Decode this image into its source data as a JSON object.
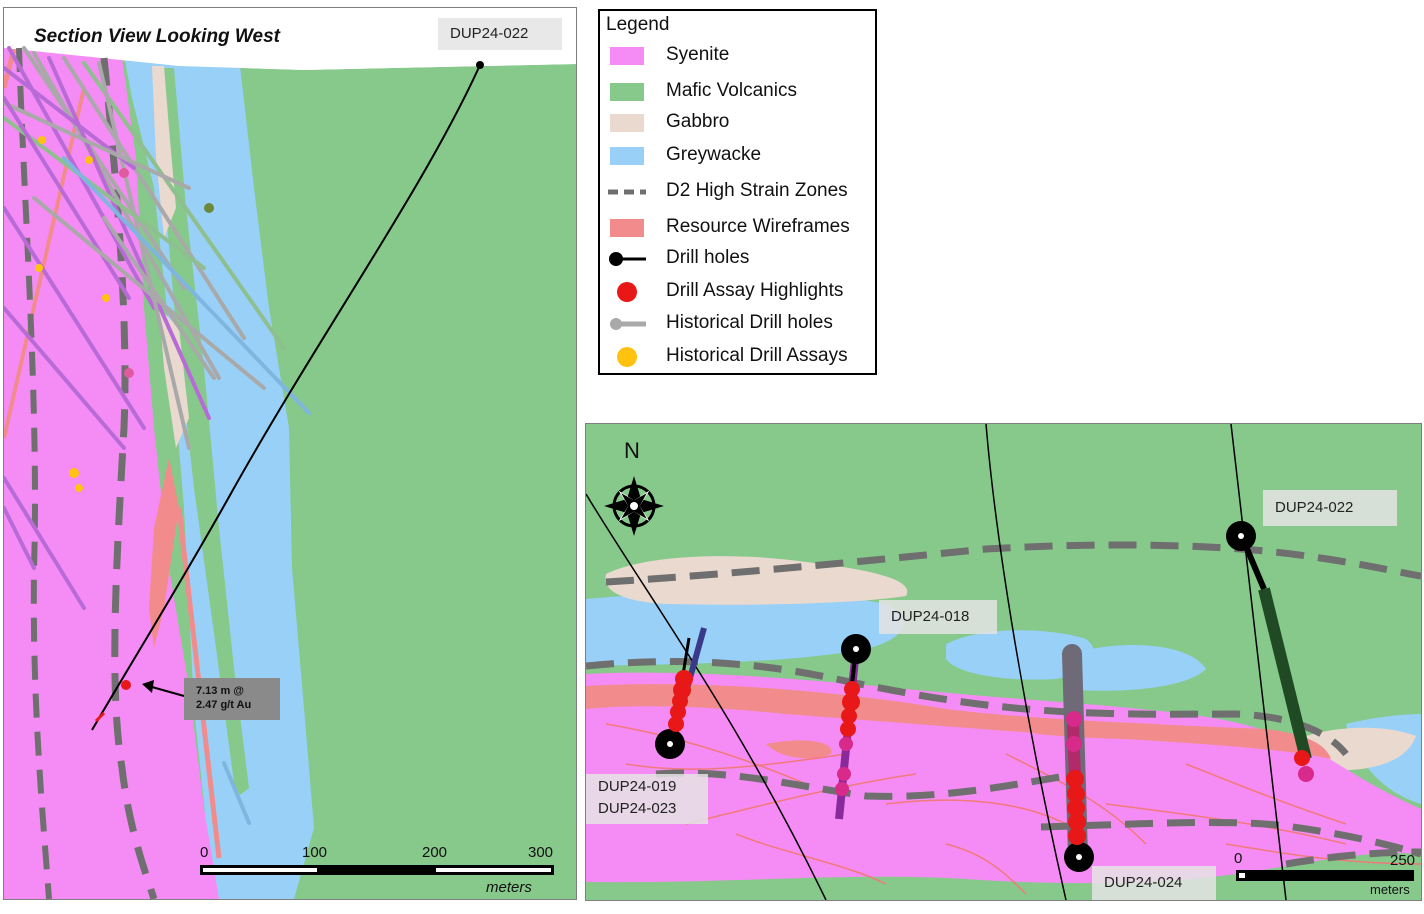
{
  "section": {
    "title": "Section View Looking West",
    "hole_label": "DUP24-022",
    "assay_callout": {
      "line1": "7.13 m @",
      "line2": "2.47 g/t Au"
    },
    "scale": {
      "ticks": [
        "0",
        "100",
        "200",
        "300"
      ],
      "unit": "meters"
    }
  },
  "legend": {
    "title": "Legend",
    "items": [
      {
        "label": "Syenite",
        "color": "#f58cf5",
        "kind": "fill"
      },
      {
        "label": "Mafic Volcanics",
        "color": "#86c98a",
        "kind": "fill"
      },
      {
        "label": "Gabbro",
        "color": "#ead9cf",
        "kind": "fill"
      },
      {
        "label": "Greywacke",
        "color": "#99d0f8",
        "kind": "fill"
      },
      {
        "label": "D2 High Strain Zones",
        "color": "#666666",
        "kind": "dash"
      },
      {
        "label": "Resource Wireframes",
        "color": "#f28c8c",
        "kind": "fill"
      },
      {
        "label": "Drill holes",
        "color": "#000000",
        "kind": "line-dot"
      },
      {
        "label": "Drill Assay Highlights",
        "color": "#e81818",
        "kind": "dot"
      },
      {
        "label": "Historical Drill holes",
        "color": "#a9a9a9",
        "kind": "line-dot-grey"
      },
      {
        "label": "Historical Drill Assays",
        "color": "#ffc20e",
        "kind": "dot"
      }
    ]
  },
  "plan": {
    "north_label": "N",
    "hole_labels": {
      "dup24_022": "DUP24-022",
      "dup24_018": "DUP24-018",
      "dup24_019": "DUP24-019",
      "dup24_023": "DUP24-023",
      "dup24_024": "DUP24-024"
    },
    "scale": {
      "start": "0",
      "end": "250",
      "unit": "meters"
    }
  },
  "colors": {
    "syenite": "#f58cf5",
    "mafic": "#86c98a",
    "gabbro": "#ead9cf",
    "greywacke": "#99d0f8",
    "strain": "#6f6f6f",
    "wireframe": "#f28c8c",
    "assay": "#e81818",
    "historical": "#a9a9a9",
    "historical_assay": "#ffc20e"
  }
}
